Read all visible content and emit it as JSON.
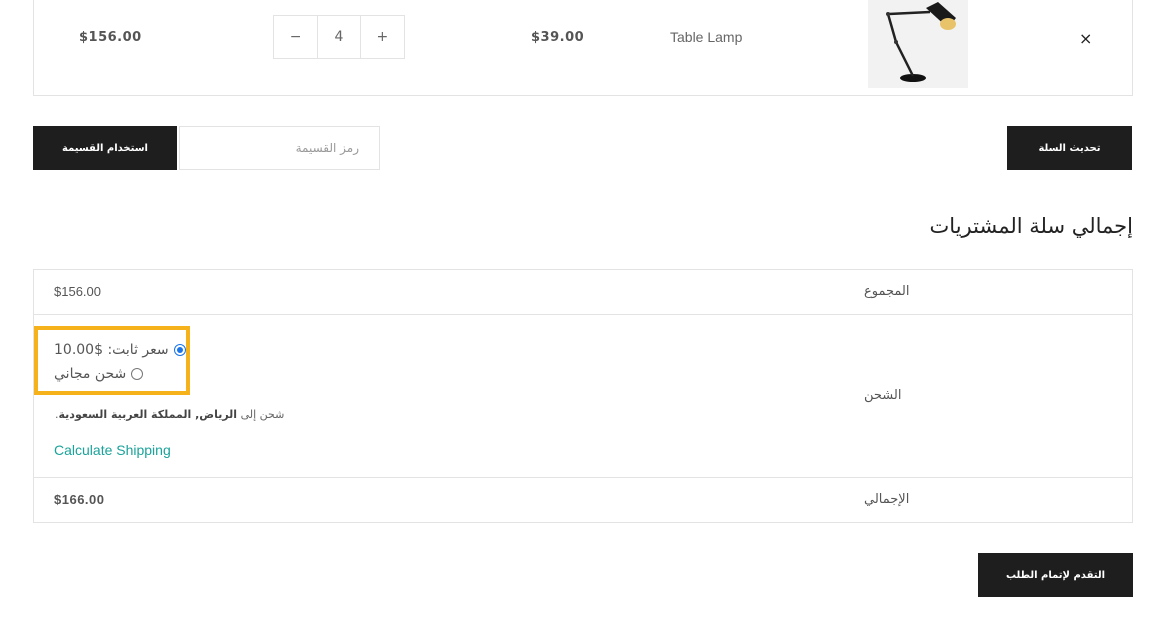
{
  "cart_item": {
    "subtotal": "$156.00",
    "quantity": "4",
    "minus": "−",
    "plus": "+",
    "price": "$39.00",
    "name": "Table Lamp",
    "remove": "×"
  },
  "coupon": {
    "button_label": "استخدام القسيمة",
    "placeholder": "رمز القسيمة"
  },
  "update_cart_label": "تحديث السلة",
  "totals": {
    "title": "إجمالي سلة المشتريات",
    "subtotal_label": "المجموع",
    "subtotal_value": "$156.00",
    "shipping_label": "الشحن",
    "options": {
      "flat_rate": "سعر ثابت: $10.00",
      "free_shipping": "شحن مجاني"
    },
    "shipping_to_prefix": "شحن إلى",
    "shipping_destination": "الرياض, المملكة العربية السعودية",
    "shipping_to_suffix": ".",
    "calculate_shipping": "Calculate Shipping",
    "total_label": "الإجمالي",
    "total_value": "$166.00"
  },
  "checkout_label": "التقدم لإتمام الطلب",
  "colors": {
    "button_bg": "#1e1e1e",
    "highlight_border": "#f5b21b",
    "link": "#1aa39a",
    "radio_selected": "#1a73e8"
  }
}
